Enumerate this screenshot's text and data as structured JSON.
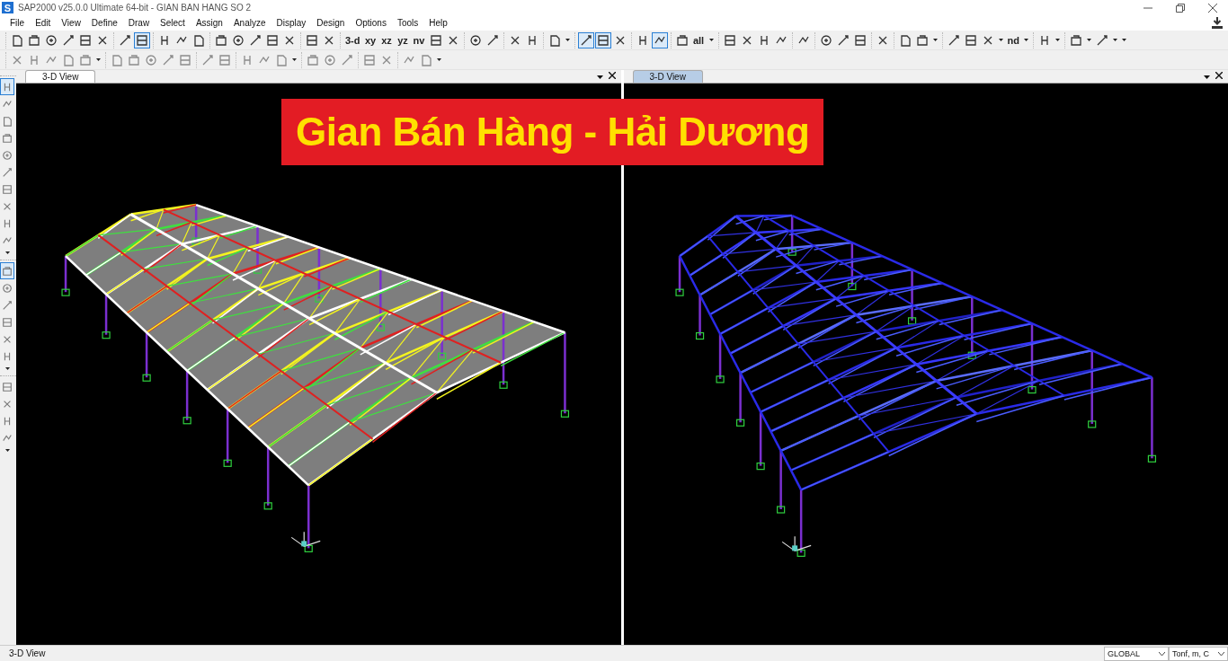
{
  "window": {
    "title": "SAP2000 v25.0.0 Ultimate 64-bit - GIAN BAN HANG SO 2",
    "app_letter": "S"
  },
  "menu": [
    "File",
    "Edit",
    "View",
    "Define",
    "Draw",
    "Select",
    "Assign",
    "Analyze",
    "Display",
    "Design",
    "Options",
    "Tools",
    "Help"
  ],
  "toolbar_1": [
    [
      {
        "kind": "icon",
        "selected": false
      },
      {
        "kind": "icon",
        "selected": false
      },
      {
        "kind": "icon",
        "selected": false
      },
      {
        "kind": "icon",
        "selected": false
      },
      {
        "kind": "icon",
        "selected": false
      },
      {
        "kind": "icon",
        "selected": false
      }
    ],
    [
      {
        "kind": "icon",
        "selected": false
      },
      {
        "kind": "icon",
        "selected": true
      }
    ],
    [
      {
        "kind": "icon",
        "selected": false
      },
      {
        "kind": "icon",
        "selected": false
      },
      {
        "kind": "icon",
        "selected": false
      }
    ],
    [
      {
        "kind": "icon",
        "selected": false
      },
      {
        "kind": "icon",
        "selected": false
      },
      {
        "kind": "icon",
        "selected": false
      },
      {
        "kind": "icon",
        "selected": false
      },
      {
        "kind": "icon",
        "selected": false
      }
    ],
    [
      {
        "kind": "icon",
        "selected": false
      },
      {
        "kind": "icon",
        "selected": false
      }
    ],
    [
      {
        "kind": "text",
        "label": "3-d",
        "selected": false
      },
      {
        "kind": "text",
        "label": "xy",
        "selected": false
      },
      {
        "kind": "text",
        "label": "xz",
        "selected": false
      },
      {
        "kind": "text",
        "label": "yz",
        "selected": false
      },
      {
        "kind": "text",
        "label": "nv",
        "selected": false
      },
      {
        "kind": "icon",
        "selected": false
      },
      {
        "kind": "icon",
        "selected": false
      }
    ],
    [
      {
        "kind": "icon",
        "selected": false
      },
      {
        "kind": "icon",
        "selected": false
      }
    ],
    [
      {
        "kind": "icon",
        "selected": false
      },
      {
        "kind": "icon",
        "selected": false
      }
    ],
    [
      {
        "kind": "icon",
        "selected": false
      },
      {
        "kind": "dropdown",
        "selected": false
      }
    ],
    [
      {
        "kind": "icon",
        "selected": true
      },
      {
        "kind": "icon",
        "selected": true
      },
      {
        "kind": "icon",
        "selected": false
      }
    ],
    [
      {
        "kind": "icon",
        "selected": false
      },
      {
        "kind": "icon",
        "selected": true
      }
    ],
    [
      {
        "kind": "icon",
        "selected": false
      },
      {
        "kind": "text",
        "label": "all",
        "selected": false
      },
      {
        "kind": "dropdown",
        "selected": false
      }
    ],
    [
      {
        "kind": "icon",
        "selected": false
      },
      {
        "kind": "icon",
        "selected": false
      },
      {
        "kind": "icon",
        "selected": false
      },
      {
        "kind": "icon",
        "selected": false
      }
    ],
    [
      {
        "kind": "icon",
        "selected": false
      }
    ],
    [
      {
        "kind": "icon",
        "selected": false
      },
      {
        "kind": "icon",
        "selected": false
      },
      {
        "kind": "icon",
        "selected": false
      }
    ],
    [
      {
        "kind": "icon",
        "selected": false
      }
    ],
    [
      {
        "kind": "icon",
        "selected": false
      },
      {
        "kind": "icon",
        "selected": false
      },
      {
        "kind": "dropdown",
        "selected": false
      }
    ],
    [
      {
        "kind": "icon",
        "selected": false
      },
      {
        "kind": "icon",
        "selected": false
      },
      {
        "kind": "icon",
        "selected": false
      },
      {
        "kind": "dropdown",
        "selected": false
      },
      {
        "kind": "text",
        "label": "nd",
        "selected": false
      },
      {
        "kind": "dropdown",
        "selected": false
      }
    ],
    [
      {
        "kind": "icon",
        "selected": false
      },
      {
        "kind": "dropdown",
        "selected": false
      }
    ],
    [
      {
        "kind": "icon",
        "selected": false
      },
      {
        "kind": "dropdown",
        "selected": false
      },
      {
        "kind": "icon",
        "selected": false
      },
      {
        "kind": "dropdown",
        "selected": false
      },
      {
        "kind": "dropdown",
        "selected": false
      }
    ]
  ],
  "toolbar_2": [
    [
      {
        "kind": "icon",
        "selected": false
      },
      {
        "kind": "icon",
        "selected": false
      },
      {
        "kind": "icon",
        "selected": false
      },
      {
        "kind": "icon",
        "selected": false
      },
      {
        "kind": "icon",
        "selected": false
      },
      {
        "kind": "dropdown",
        "selected": false
      }
    ],
    [
      {
        "kind": "icon",
        "selected": false
      },
      {
        "kind": "icon",
        "selected": false
      },
      {
        "kind": "icon",
        "selected": false
      },
      {
        "kind": "icon",
        "selected": false
      },
      {
        "kind": "icon",
        "selected": false
      }
    ],
    [
      {
        "kind": "icon",
        "selected": false
      },
      {
        "kind": "icon",
        "selected": false
      }
    ],
    [
      {
        "kind": "icon",
        "selected": false
      },
      {
        "kind": "icon",
        "selected": false
      },
      {
        "kind": "icon",
        "selected": false
      },
      {
        "kind": "dropdown",
        "selected": false
      }
    ],
    [
      {
        "kind": "icon",
        "selected": false
      },
      {
        "kind": "icon",
        "selected": false
      },
      {
        "kind": "icon",
        "selected": false
      }
    ],
    [
      {
        "kind": "icon",
        "selected": false
      },
      {
        "kind": "icon",
        "selected": false
      }
    ],
    [
      {
        "kind": "icon",
        "selected": false
      },
      {
        "kind": "icon",
        "selected": false
      },
      {
        "kind": "dropdown",
        "selected": false
      }
    ]
  ],
  "side_toolbar": [
    [
      {
        "kind": "icon",
        "selected": true
      },
      {
        "kind": "icon",
        "selected": false
      },
      {
        "kind": "icon",
        "selected": false
      },
      {
        "kind": "icon",
        "selected": false
      },
      {
        "kind": "icon",
        "selected": false
      },
      {
        "kind": "icon",
        "selected": false
      },
      {
        "kind": "icon",
        "selected": false
      },
      {
        "kind": "icon",
        "selected": false
      },
      {
        "kind": "icon",
        "selected": false
      },
      {
        "kind": "icon",
        "selected": false
      },
      {
        "kind": "dropdown",
        "selected": false
      }
    ],
    [
      {
        "kind": "icon",
        "selected": true
      },
      {
        "kind": "icon",
        "selected": false
      },
      {
        "kind": "icon",
        "selected": false
      },
      {
        "kind": "icon",
        "selected": false
      },
      {
        "kind": "icon",
        "selected": false
      },
      {
        "kind": "icon",
        "selected": false
      },
      {
        "kind": "dropdown",
        "selected": false
      }
    ],
    [
      {
        "kind": "icon",
        "selected": false
      },
      {
        "kind": "icon",
        "selected": false
      },
      {
        "kind": "icon",
        "selected": false
      },
      {
        "kind": "icon",
        "selected": false
      },
      {
        "kind": "dropdown",
        "selected": false
      }
    ]
  ],
  "views": [
    {
      "tab": "3-D View",
      "selected": false,
      "kind": "shaded"
    },
    {
      "tab": "3-D View",
      "selected": true,
      "kind": "frame"
    }
  ],
  "banner": "Gian Bán Hàng - Hải Dương",
  "status_bar": {
    "text": "3-D View",
    "coordinate_system": "GLOBAL",
    "units": "Tonf, m, C"
  }
}
